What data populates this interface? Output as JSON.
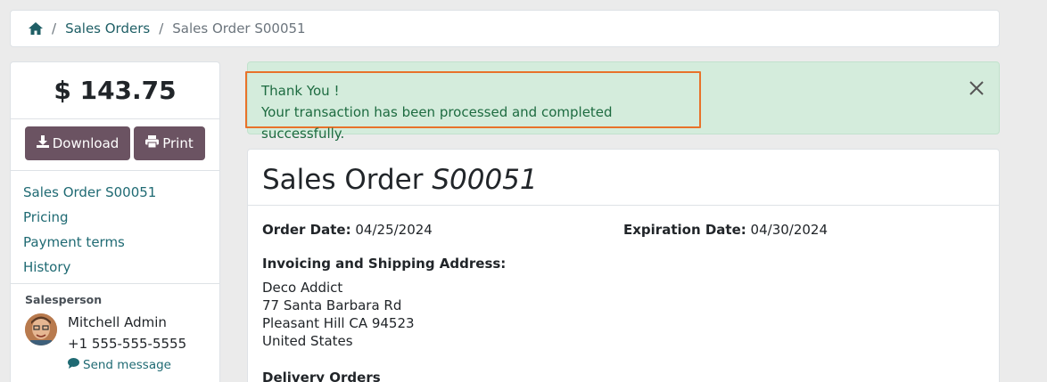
{
  "breadcrumb": {
    "home_icon": "home-icon",
    "items": [
      "Sales Orders",
      "Sales Order S00051"
    ]
  },
  "sidebar": {
    "amount": "$ 143.75",
    "download_label": "Download",
    "print_label": "Print",
    "nav": [
      "Sales Order S00051",
      "Pricing",
      "Payment terms",
      "History"
    ],
    "salesperson": {
      "heading": "Salesperson",
      "name": "Mitchell Admin",
      "phone": "+1 555-555-5555",
      "send_message": "Send message"
    }
  },
  "alert": {
    "title": "Thank You !",
    "message": "Your transaction has been processed and completed successfully."
  },
  "order": {
    "title_prefix": "Sales Order",
    "number": "S00051",
    "order_date_label": "Order Date:",
    "order_date": "04/25/2024",
    "expiration_date_label": "Expiration Date:",
    "expiration_date": "04/30/2024",
    "address_title": "Invoicing and Shipping Address:",
    "address_lines": [
      "Deco Addict",
      "77 Santa Barbara Rd",
      "Pleasant Hill CA 94523",
      "United States"
    ],
    "delivery_title": "Delivery Orders"
  },
  "colors": {
    "accent": "#6b5362",
    "link": "#1f6a73",
    "alert_bg": "#d4ecdc",
    "highlight": "#e8722a"
  }
}
